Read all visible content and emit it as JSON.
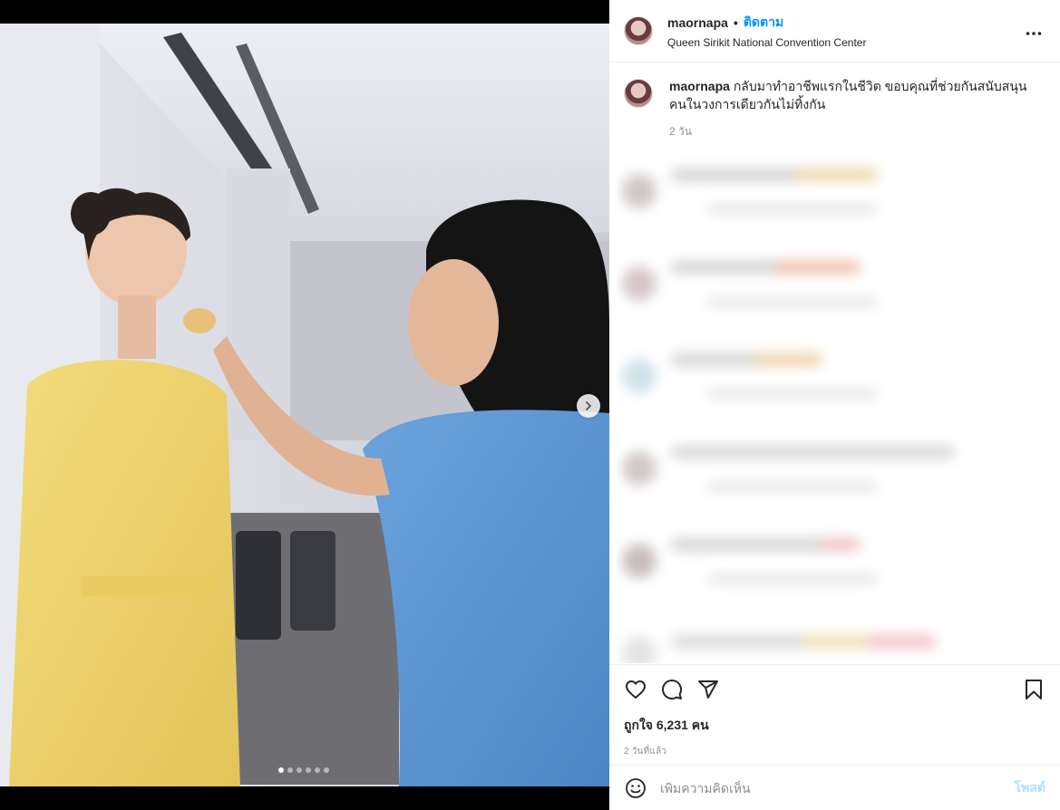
{
  "post": {
    "username": "maornapa",
    "separator": "•",
    "follow_label": "ติดตาม",
    "location": "Queen Sirikit National Convention Center",
    "more_icon": "more-options-icon",
    "caption_line1": "กลับมาทำอาชีพแรกในชีวิต ขอบคุณที่ช่วยกันสนับสนุน",
    "caption_line2": "คนในวงการเดียวกันไม่ทิ้งกัน",
    "caption_time": "2 วัน",
    "likes_label": "ถูกใจ 6,231 คน",
    "posted_time": "2 วันที่แล้ว"
  },
  "media": {
    "carousel_total": 6,
    "carousel_active": 1,
    "next_icon": "chevron-right-icon"
  },
  "actions": {
    "like_icon": "heart-icon",
    "comment_icon": "comment-icon",
    "share_icon": "share-icon",
    "save_icon": "bookmark-icon"
  },
  "comment_box": {
    "emoji_icon": "emoji-icon",
    "placeholder": "เพิ่มความคิดเห็น",
    "post_label": "โพสต์"
  },
  "colors": {
    "accent": "#0095f6",
    "post_disabled": "#b2dffc",
    "secondary_text": "#8e8e8e"
  }
}
